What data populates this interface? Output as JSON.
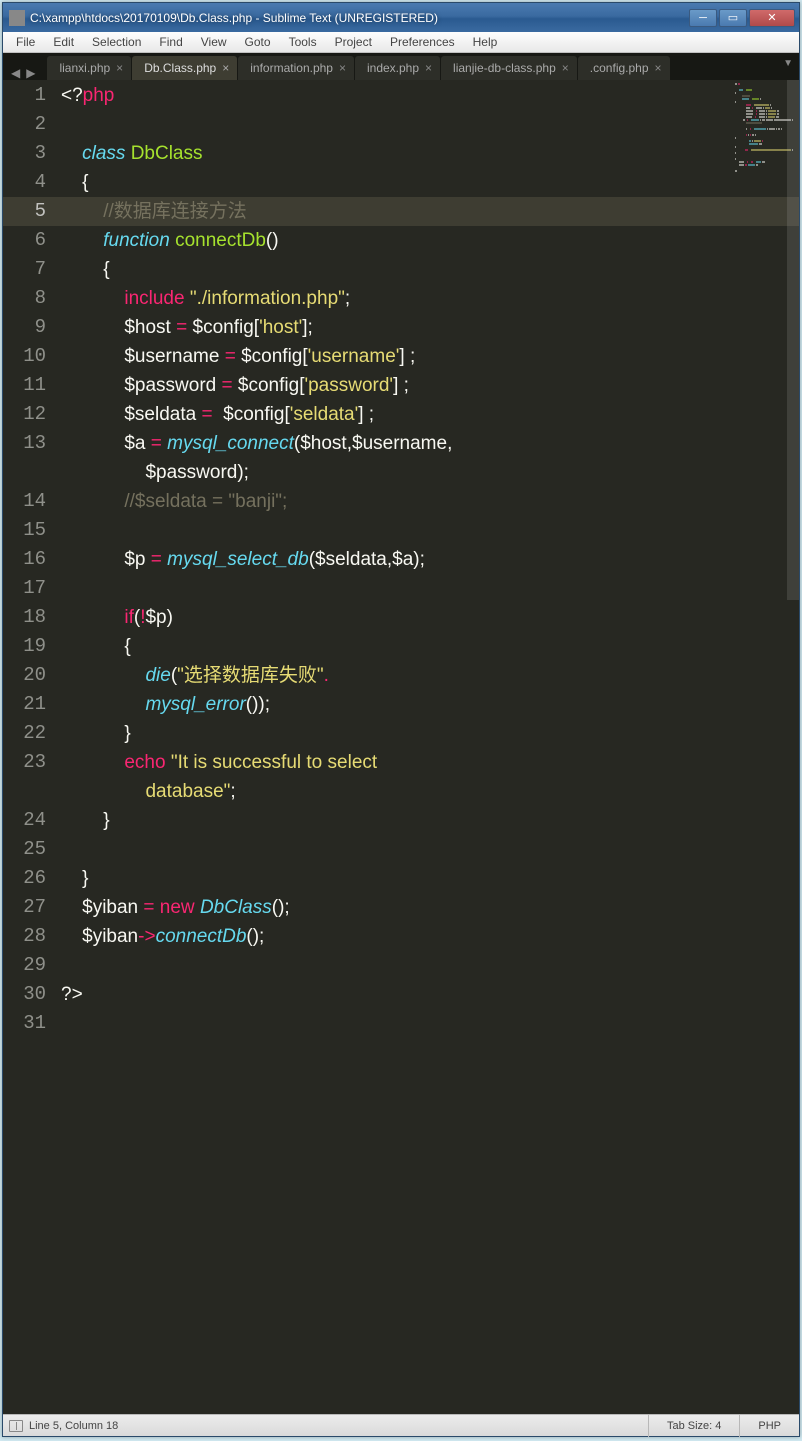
{
  "window": {
    "title": "C:\\xampp\\htdocs\\20170109\\Db.Class.php - Sublime Text (UNREGISTERED)"
  },
  "menu": [
    "File",
    "Edit",
    "Selection",
    "Find",
    "View",
    "Goto",
    "Tools",
    "Project",
    "Preferences",
    "Help"
  ],
  "tabs": [
    {
      "label": "lianxi.php"
    },
    {
      "label": "Db.Class.php",
      "active": true
    },
    {
      "label": "information.php"
    },
    {
      "label": "index.php"
    },
    {
      "label": "lianjie-db-class.php"
    },
    {
      "label": ".config.php"
    }
  ],
  "cursor_line": 5,
  "line_count": 31,
  "code_lines": [
    [
      {
        "t": "<?",
        "c": "c-punc"
      },
      {
        "t": "php",
        "c": "c-fn"
      }
    ],
    [],
    [
      {
        "t": "    ",
        "c": ""
      },
      {
        "t": "class",
        "c": "c-kw"
      },
      {
        "t": " ",
        "c": ""
      },
      {
        "t": "DbClass",
        "c": "c-name"
      }
    ],
    [
      {
        "t": "    {",
        "c": "c-punc"
      }
    ],
    [
      {
        "t": "        ",
        "c": ""
      },
      {
        "t": "//数据库连接方法",
        "c": "c-cmt"
      }
    ],
    [
      {
        "t": "        ",
        "c": ""
      },
      {
        "t": "function",
        "c": "c-kw"
      },
      {
        "t": " ",
        "c": ""
      },
      {
        "t": "connectDb",
        "c": "c-name"
      },
      {
        "t": "()",
        "c": "c-punc"
      }
    ],
    [
      {
        "t": "        {",
        "c": "c-punc"
      }
    ],
    [
      {
        "t": "            ",
        "c": ""
      },
      {
        "t": "include",
        "c": "c-inc"
      },
      {
        "t": " ",
        "c": ""
      },
      {
        "t": "\"./information.php\"",
        "c": "c-str"
      },
      {
        "t": ";",
        "c": "c-punc"
      }
    ],
    [
      {
        "t": "            ",
        "c": ""
      },
      {
        "t": "$host",
        "c": "c-var"
      },
      {
        "t": " ",
        "c": ""
      },
      {
        "t": "=",
        "c": "c-op"
      },
      {
        "t": " ",
        "c": ""
      },
      {
        "t": "$config",
        "c": "c-var"
      },
      {
        "t": "[",
        "c": "c-punc"
      },
      {
        "t": "'host'",
        "c": "c-str"
      },
      {
        "t": "];",
        "c": "c-punc"
      }
    ],
    [
      {
        "t": "            ",
        "c": ""
      },
      {
        "t": "$username",
        "c": "c-var"
      },
      {
        "t": " ",
        "c": ""
      },
      {
        "t": "=",
        "c": "c-op"
      },
      {
        "t": " ",
        "c": ""
      },
      {
        "t": "$config",
        "c": "c-var"
      },
      {
        "t": "[",
        "c": "c-punc"
      },
      {
        "t": "'username'",
        "c": "c-str"
      },
      {
        "t": "] ;",
        "c": "c-punc"
      }
    ],
    [
      {
        "t": "            ",
        "c": ""
      },
      {
        "t": "$password",
        "c": "c-var"
      },
      {
        "t": " ",
        "c": ""
      },
      {
        "t": "=",
        "c": "c-op"
      },
      {
        "t": " ",
        "c": ""
      },
      {
        "t": "$config",
        "c": "c-var"
      },
      {
        "t": "[",
        "c": "c-punc"
      },
      {
        "t": "'password'",
        "c": "c-str"
      },
      {
        "t": "] ;",
        "c": "c-punc"
      }
    ],
    [
      {
        "t": "            ",
        "c": ""
      },
      {
        "t": "$seldata",
        "c": "c-var"
      },
      {
        "t": " ",
        "c": ""
      },
      {
        "t": "=",
        "c": "c-op"
      },
      {
        "t": "  ",
        "c": ""
      },
      {
        "t": "$config",
        "c": "c-var"
      },
      {
        "t": "[",
        "c": "c-punc"
      },
      {
        "t": "'seldata'",
        "c": "c-str"
      },
      {
        "t": "] ;",
        "c": "c-punc"
      }
    ],
    [
      {
        "t": "            ",
        "c": ""
      },
      {
        "t": "$a",
        "c": "c-var"
      },
      {
        "t": " ",
        "c": ""
      },
      {
        "t": "=",
        "c": "c-op"
      },
      {
        "t": " ",
        "c": ""
      },
      {
        "t": "mysql_connect",
        "c": "c-kw"
      },
      {
        "t": "(",
        "c": "c-punc"
      },
      {
        "t": "$host",
        "c": "c-var"
      },
      {
        "t": ",",
        "c": "c-punc"
      },
      {
        "t": "$username",
        "c": "c-var"
      },
      {
        "t": ",\n                $password",
        "c": "c-var"
      },
      {
        "t": ");",
        "c": "c-punc"
      }
    ],
    [
      {
        "t": "            ",
        "c": ""
      },
      {
        "t": "//$seldata = \"banji\";",
        "c": "c-cmt"
      }
    ],
    [],
    [
      {
        "t": "            ",
        "c": ""
      },
      {
        "t": "$p",
        "c": "c-var"
      },
      {
        "t": " ",
        "c": ""
      },
      {
        "t": "=",
        "c": "c-op"
      },
      {
        "t": " ",
        "c": ""
      },
      {
        "t": "mysql_select_db",
        "c": "c-kw"
      },
      {
        "t": "(",
        "c": "c-punc"
      },
      {
        "t": "$seldata",
        "c": "c-var"
      },
      {
        "t": ",",
        "c": "c-punc"
      },
      {
        "t": "$a",
        "c": "c-var"
      },
      {
        "t": ");",
        "c": "c-punc"
      }
    ],
    [],
    [
      {
        "t": "            ",
        "c": ""
      },
      {
        "t": "if",
        "c": "c-fn"
      },
      {
        "t": "(",
        "c": "c-punc"
      },
      {
        "t": "!",
        "c": "c-op"
      },
      {
        "t": "$p",
        "c": "c-var"
      },
      {
        "t": ")",
        "c": "c-punc"
      }
    ],
    [
      {
        "t": "            {",
        "c": "c-punc"
      }
    ],
    [
      {
        "t": "                ",
        "c": ""
      },
      {
        "t": "die",
        "c": "c-kw"
      },
      {
        "t": "(",
        "c": "c-punc"
      },
      {
        "t": "\"选择数据库失败\"",
        "c": "c-str"
      },
      {
        "t": ".",
        "c": "c-op"
      }
    ],
    [
      {
        "t": "                ",
        "c": ""
      },
      {
        "t": "mysql_error",
        "c": "c-kw"
      },
      {
        "t": "());",
        "c": "c-punc"
      }
    ],
    [
      {
        "t": "            }",
        "c": "c-punc"
      }
    ],
    [
      {
        "t": "            ",
        "c": ""
      },
      {
        "t": "echo",
        "c": "c-fn"
      },
      {
        "t": " ",
        "c": ""
      },
      {
        "t": "\"It is successful to select \n                database\"",
        "c": "c-str"
      },
      {
        "t": ";",
        "c": "c-punc"
      }
    ],
    [
      {
        "t": "        }",
        "c": "c-punc"
      }
    ],
    [],
    [
      {
        "t": "    }",
        "c": "c-punc"
      }
    ],
    [
      {
        "t": "    ",
        "c": ""
      },
      {
        "t": "$yiban",
        "c": "c-var"
      },
      {
        "t": " ",
        "c": ""
      },
      {
        "t": "=",
        "c": "c-op"
      },
      {
        "t": " ",
        "c": ""
      },
      {
        "t": "new",
        "c": "c-fn"
      },
      {
        "t": " ",
        "c": ""
      },
      {
        "t": "DbClass",
        "c": "c-kw"
      },
      {
        "t": "();",
        "c": "c-punc"
      }
    ],
    [
      {
        "t": "    ",
        "c": ""
      },
      {
        "t": "$yiban",
        "c": "c-var"
      },
      {
        "t": "->",
        "c": "c-op"
      },
      {
        "t": "connectDb",
        "c": "c-kw"
      },
      {
        "t": "();",
        "c": "c-punc"
      }
    ],
    [],
    [
      {
        "t": "?>",
        "c": "c-punc"
      }
    ],
    []
  ],
  "status": {
    "position": "Line 5, Column 18",
    "tabsize": "Tab Size: 4",
    "syntax": "PHP"
  }
}
